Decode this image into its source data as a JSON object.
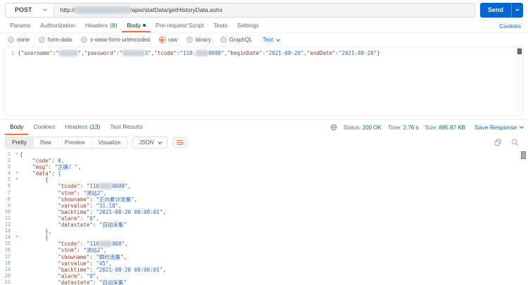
{
  "request": {
    "method": "POST",
    "url_prefix": "http://",
    "url_redacted": "█████████████",
    "url_suffix": "/ajax/statData/getHistoryData.ashx",
    "send_label": "Send",
    "tabs": [
      {
        "label": "Params"
      },
      {
        "label": "Authorization"
      },
      {
        "label": "Headers",
        "count": "(8)"
      },
      {
        "label": "Body",
        "active": true,
        "dot": true
      },
      {
        "label": "Pre-request Script"
      },
      {
        "label": "Tests"
      },
      {
        "label": "Settings"
      }
    ],
    "cookies_link": "Cookies",
    "body_modes": [
      {
        "label": "none"
      },
      {
        "label": "form-data"
      },
      {
        "label": "x-www-form-urlencoded"
      },
      {
        "label": "raw",
        "selected": true
      },
      {
        "label": "binary"
      },
      {
        "label": "GraphQL"
      }
    ],
    "body_type": "Text",
    "body_line_no": "1",
    "body_code": "{\"username\":\"██████\",\"password\":\"███████3\",\"tcode\":\"110.████0008\",\"beginDate\":\"2021-08-20\",\"endDate\":\"2021-08-20\"}"
  },
  "response": {
    "tabs": [
      {
        "label": "Body",
        "active": true
      },
      {
        "label": "Cookies"
      },
      {
        "label": "Headers",
        "count": "(13)"
      },
      {
        "label": "Test Results"
      }
    ],
    "status_label": "Status:",
    "status_value": "200 OK",
    "time_label": "Time:",
    "time_value": "2.76 s",
    "size_label": "Size:",
    "size_value": "885.87 KB",
    "save_label": "Save Response",
    "view_tabs": [
      {
        "label": "Pretty",
        "active": true
      },
      {
        "label": "Raw"
      },
      {
        "label": "Preview"
      },
      {
        "label": "Visualize"
      }
    ],
    "format": "JSON",
    "code_lines": [
      "{",
      "    \"code\": 0,",
      "    \"msg\": \"正确! \",",
      "    \"data\": [",
      "        {",
      "            \"tcode\": \"110████0008\",",
      "            \"stnm\": \"测站2\",",
      "            \"showname\": \"正向累计流量\",",
      "            \"varvalue\": \"31.18\",",
      "            \"backtime\": \"2021-08-20 00:00:01\",",
      "            \"alarm\": \"0\",",
      "            \"datastate\": \"自动采集\"",
      "        },",
      "        {",
      "            \"tcode\": \"110████008\",",
      "            \"stnm\": \"测站2\",",
      "            \"showname\": \"瞬时流量\",",
      "            \"varvalue\": \"45\",",
      "            \"backtime\": \"2021-08-20 00:00:01\",",
      "            \"alarm\": \"0\",",
      "            \"datastate\": \"自动采集\""
    ]
  }
}
